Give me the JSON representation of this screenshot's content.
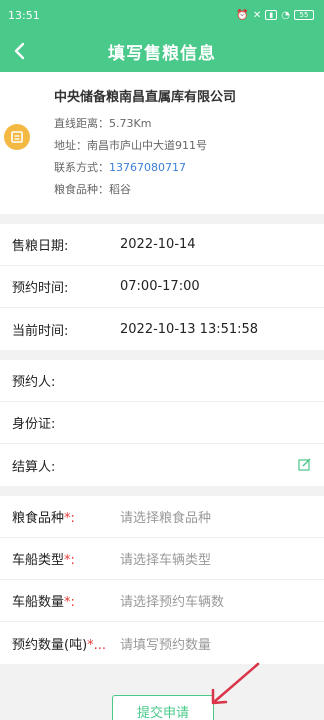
{
  "status_bar": {
    "time": "13:51",
    "battery": "55"
  },
  "header": {
    "title": "填写售粮信息"
  },
  "depot": {
    "name": "中央储备粮南昌直属库有限公司",
    "distance_label": "直线距离：",
    "distance_value": "5.73Km",
    "address_label": "地址：",
    "address_value": "南昌市庐山中大道911号",
    "contact_label": "联系方式：",
    "contact_value": "13767080717",
    "grain_label": "粮食品种：",
    "grain_value": "稻谷"
  },
  "schedule": [
    {
      "label": "售粮日期:",
      "value": "2022-10-14"
    },
    {
      "label": "预约时间:",
      "value": "07:00-17:00"
    },
    {
      "label": "当前时间:",
      "value": "2022-10-13 13:51:58"
    }
  ],
  "person": [
    {
      "label": "预约人:"
    },
    {
      "label": "身份证:"
    },
    {
      "label": "结算人:"
    }
  ],
  "form": [
    {
      "label": "粮食品种",
      "req": "*:",
      "placeholder": "请选择粮食品种"
    },
    {
      "label": "车船类型",
      "req": "*:",
      "placeholder": "请选择车辆类型"
    },
    {
      "label": "车船数量",
      "req": "*:",
      "placeholder": "请选择预约车辆数"
    },
    {
      "label": "预约数量(吨)",
      "req": "*...",
      "placeholder": "请填写预约数量"
    }
  ],
  "submit_label": "提交申请",
  "colors": {
    "primary": "#49c98a",
    "required": "#e53935",
    "link": "#3b7fd8"
  }
}
